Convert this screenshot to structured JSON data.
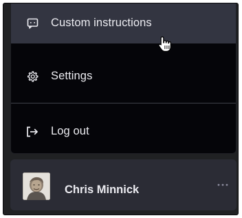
{
  "menu": {
    "items": [
      {
        "label": "Custom instructions",
        "icon": "chat-bubble-icon",
        "hovered": true
      },
      {
        "label": "Settings",
        "icon": "gear-icon",
        "hovered": false
      },
      {
        "label": "Log out",
        "icon": "logout-icon",
        "hovered": false
      }
    ]
  },
  "user": {
    "name": "Chris Minnick",
    "more_icon": "ellipsis-icon"
  },
  "colors": {
    "background": "#202123",
    "menu_background": "#050509",
    "hover_background": "#333541",
    "user_row_background": "#2b2c35",
    "text": "#ececf1"
  },
  "cursor": "hand-pointer-icon"
}
